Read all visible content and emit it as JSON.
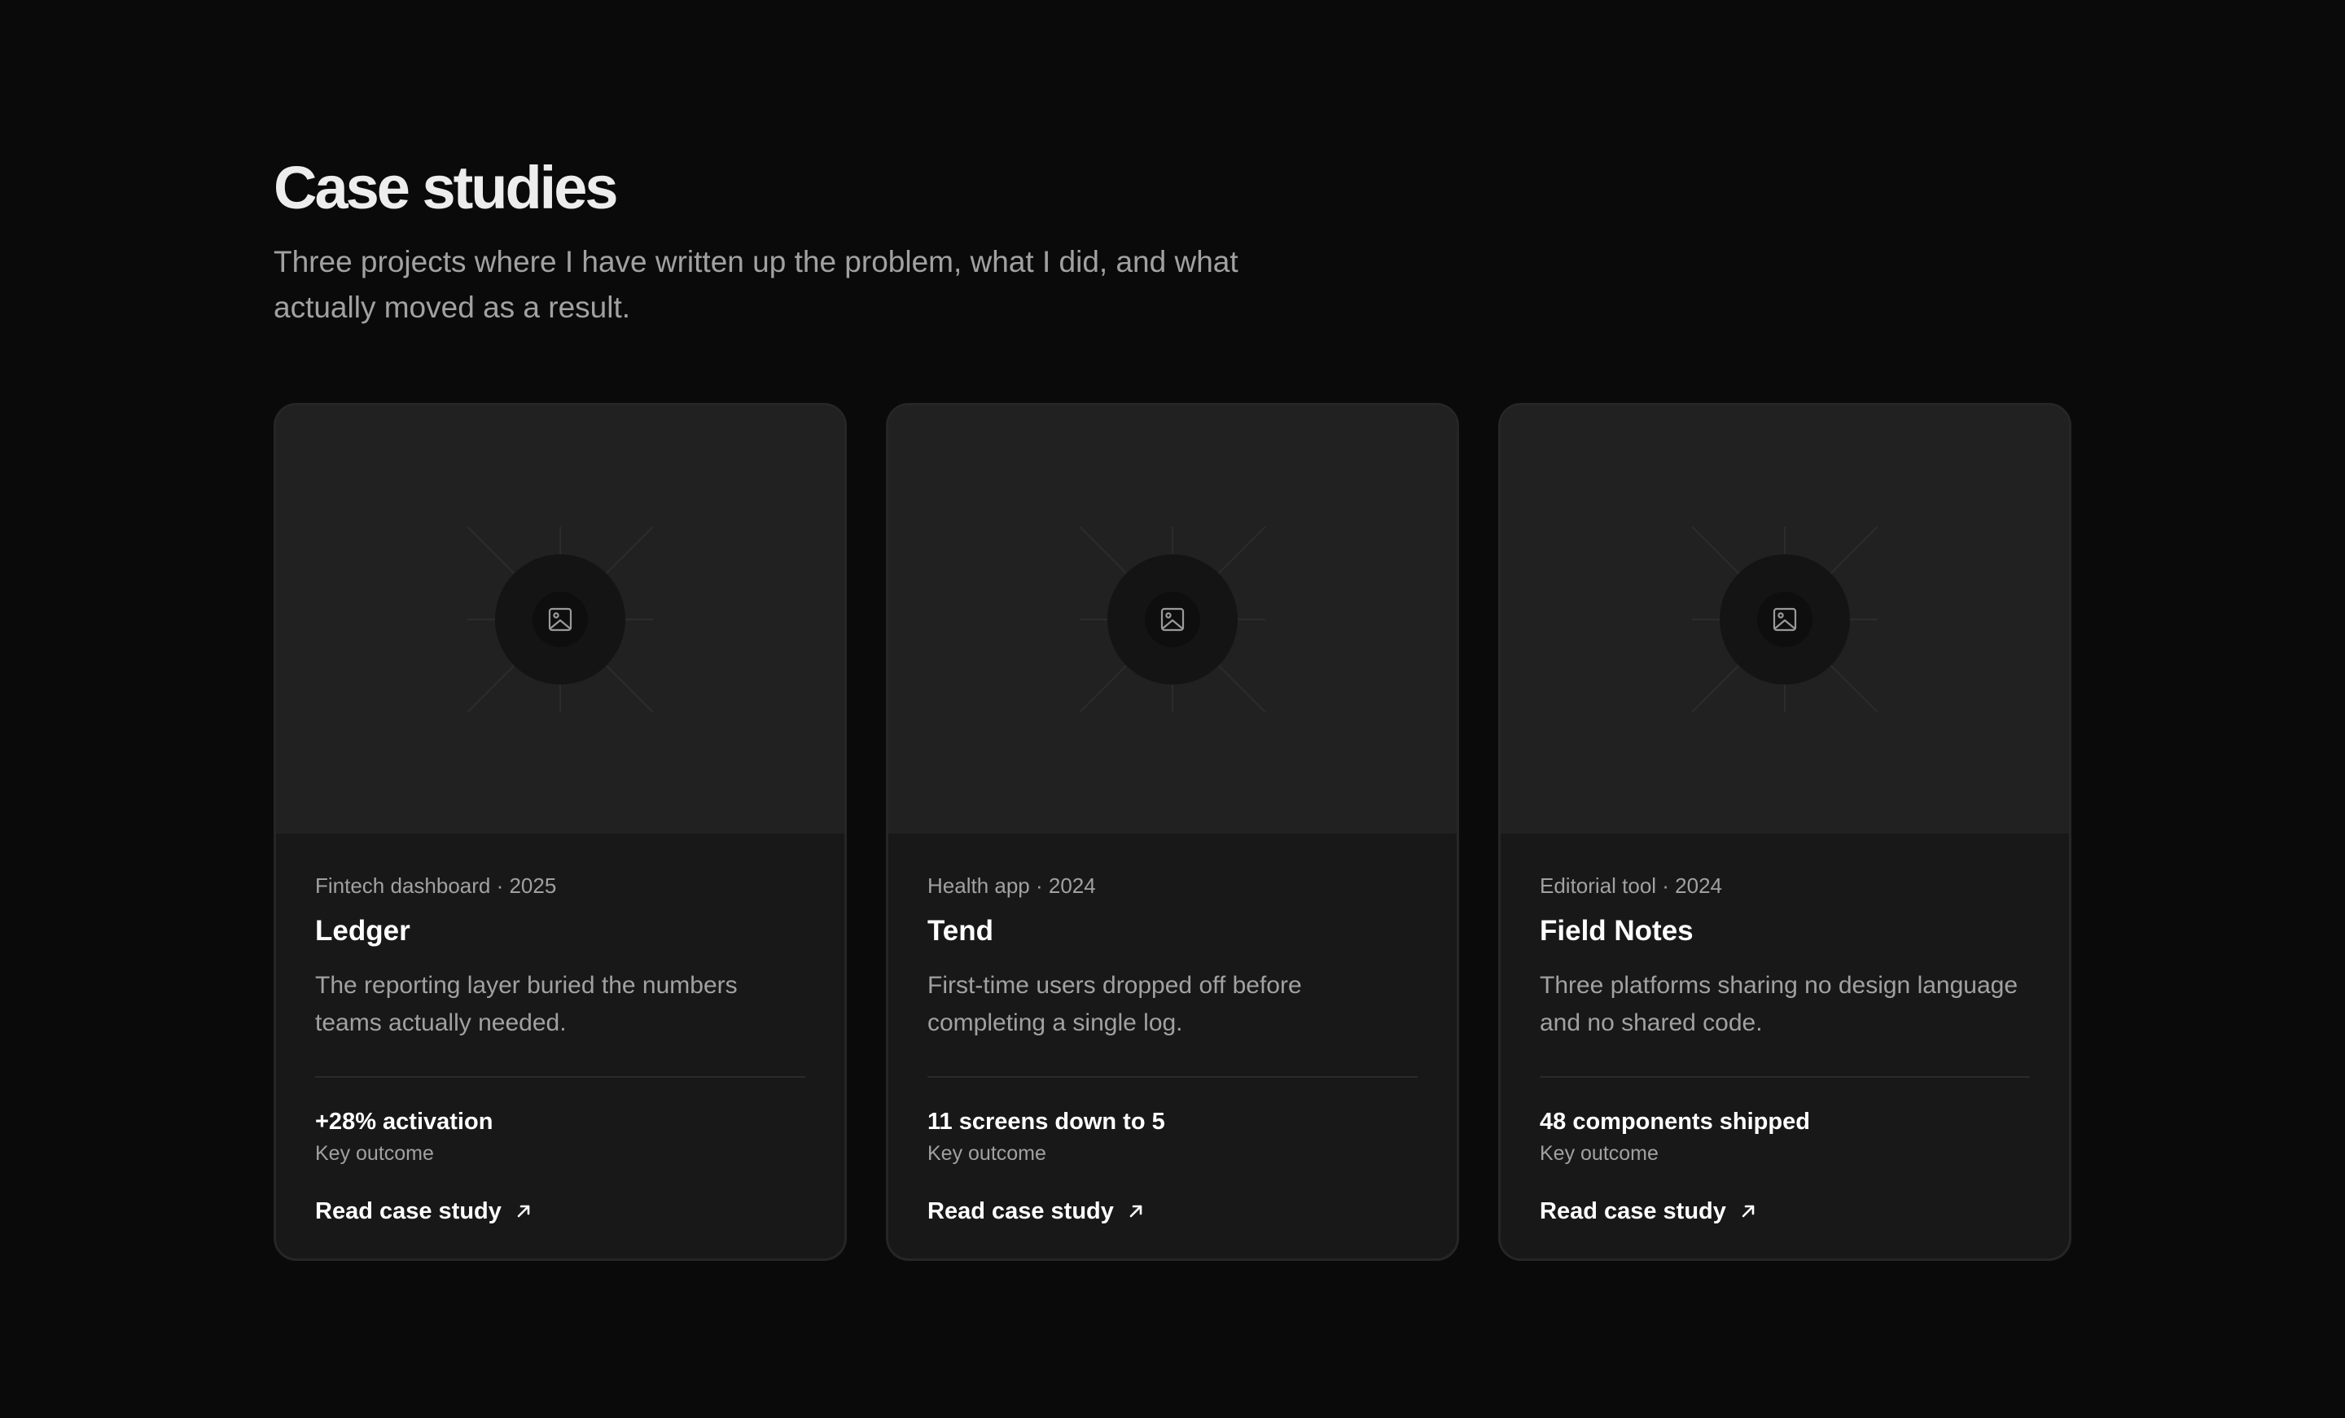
{
  "section": {
    "title": "Case studies",
    "subtitle": "Three projects where I have written up the problem, what I did, and what actually moved as a result."
  },
  "colors": {
    "background": "#0a0a0a",
    "card": "#181818",
    "card_media": "#212121",
    "muted_text": "#a1a1a1",
    "primary_text": "#ffffff"
  },
  "cards": [
    {
      "meta": "Fintech dashboard · 2025",
      "title": "Ledger",
      "description": "The reporting layer buried the numbers teams actually needed.",
      "outcome": "+28% activation",
      "outcome_label": "Key outcome",
      "link_label": "Read case study",
      "media_icon": "image-icon",
      "link_icon": "arrow-up-right-icon"
    },
    {
      "meta": "Health app · 2024",
      "title": "Tend",
      "description": "First-time users dropped off before completing a single log.",
      "outcome": "11 screens down to 5",
      "outcome_label": "Key outcome",
      "link_label": "Read case study",
      "media_icon": "image-icon",
      "link_icon": "arrow-up-right-icon"
    },
    {
      "meta": "Editorial tool · 2024",
      "title": "Field Notes",
      "description": "Three platforms sharing no design language and no shared code.",
      "outcome": "48 components shipped",
      "outcome_label": "Key outcome",
      "link_label": "Read case study",
      "media_icon": "image-icon",
      "link_icon": "arrow-up-right-icon"
    }
  ]
}
